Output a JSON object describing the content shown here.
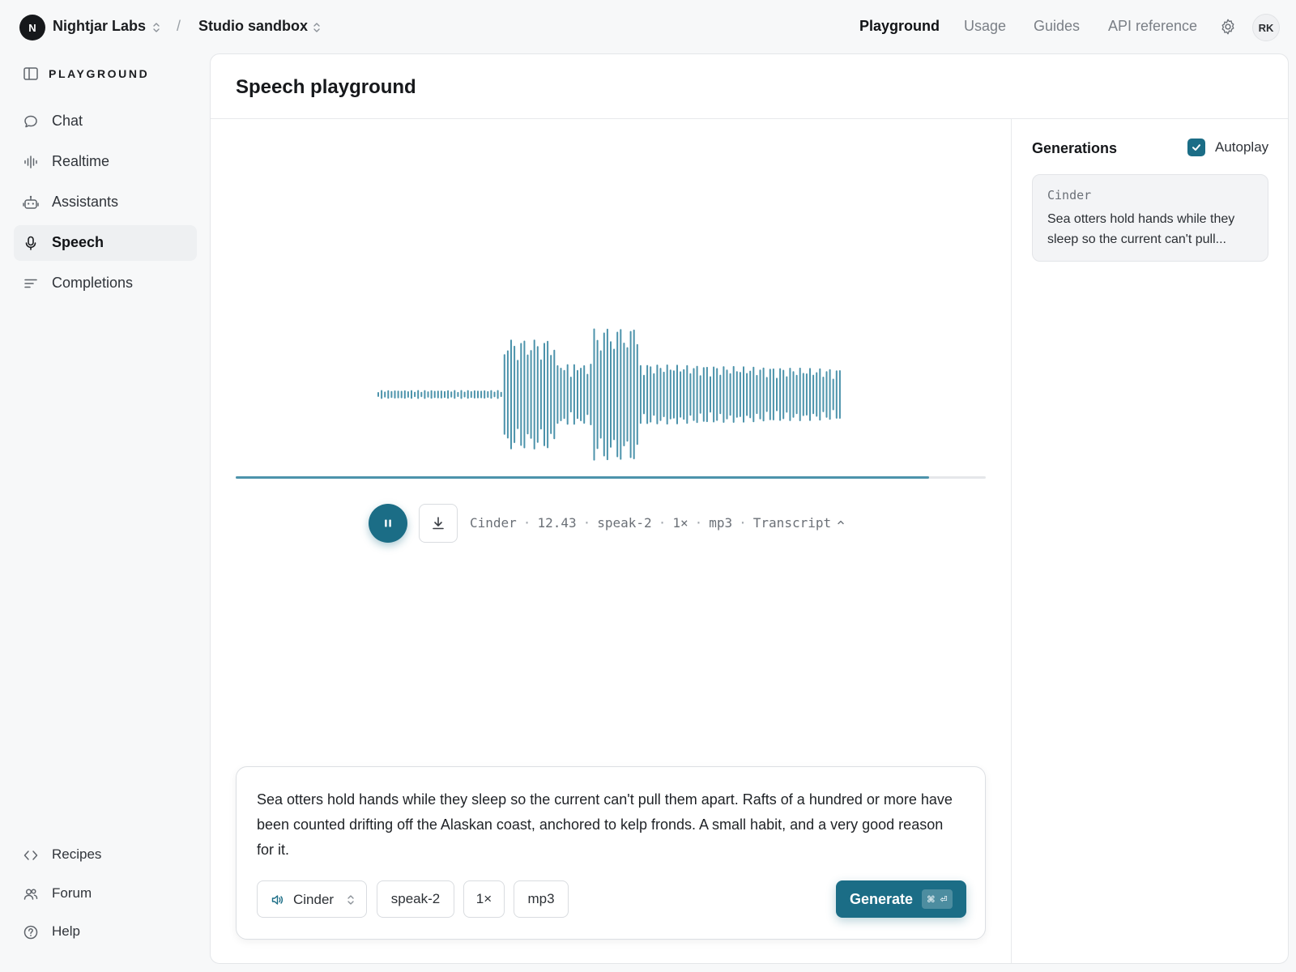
{
  "header": {
    "org_initial": "N",
    "org_name": "Nightjar Labs",
    "separator": "/",
    "project_name": "Studio sandbox",
    "nav": [
      "Playground",
      "Usage",
      "Guides",
      "API reference"
    ],
    "active_nav": "Playground",
    "user_initials": "RK"
  },
  "sidebar": {
    "section_label": "PLAYGROUND",
    "items": [
      {
        "label": "Chat",
        "icon": "chat-bubble-icon"
      },
      {
        "label": "Realtime",
        "icon": "audio-bars-icon"
      },
      {
        "label": "Assistants",
        "icon": "robot-icon"
      },
      {
        "label": "Speech",
        "icon": "microphone-icon",
        "active": true
      },
      {
        "label": "Completions",
        "icon": "text-lines-icon"
      }
    ],
    "bottom_items": [
      {
        "label": "Recipes",
        "icon": "code-icon"
      },
      {
        "label": "Forum",
        "icon": "users-icon"
      },
      {
        "label": "Help",
        "icon": "help-circle-icon"
      }
    ]
  },
  "main": {
    "title": "Speech playground",
    "player": {
      "progress": 0.924,
      "meta": {
        "voice": "Cinder",
        "duration": "12.43",
        "model": "speak-2",
        "speed": "1×",
        "format": "mp3",
        "transcript_label": "Transcript"
      }
    },
    "composer": {
      "text": "Sea otters hold hands while they sleep so the current can't pull them apart. Rafts of a hundred or more have been counted drifting off the Alaskan coast, anchored to kelp fronds. A small habit, and a very good reason for it.",
      "voice": "Cinder",
      "model": "speak-2",
      "speed": "1×",
      "format": "mp3",
      "generate_label": "Generate"
    }
  },
  "generations": {
    "title": "Generations",
    "autoplay_label": "Autoplay",
    "autoplay_checked": true,
    "items": [
      {
        "voice": "Cinder",
        "preview": "Sea otters hold hands while they sleep so the current can't pull..."
      }
    ]
  },
  "colors": {
    "accent": "#1b6d86",
    "waveform": "#4c93ab",
    "background": "#f7f8f9"
  }
}
